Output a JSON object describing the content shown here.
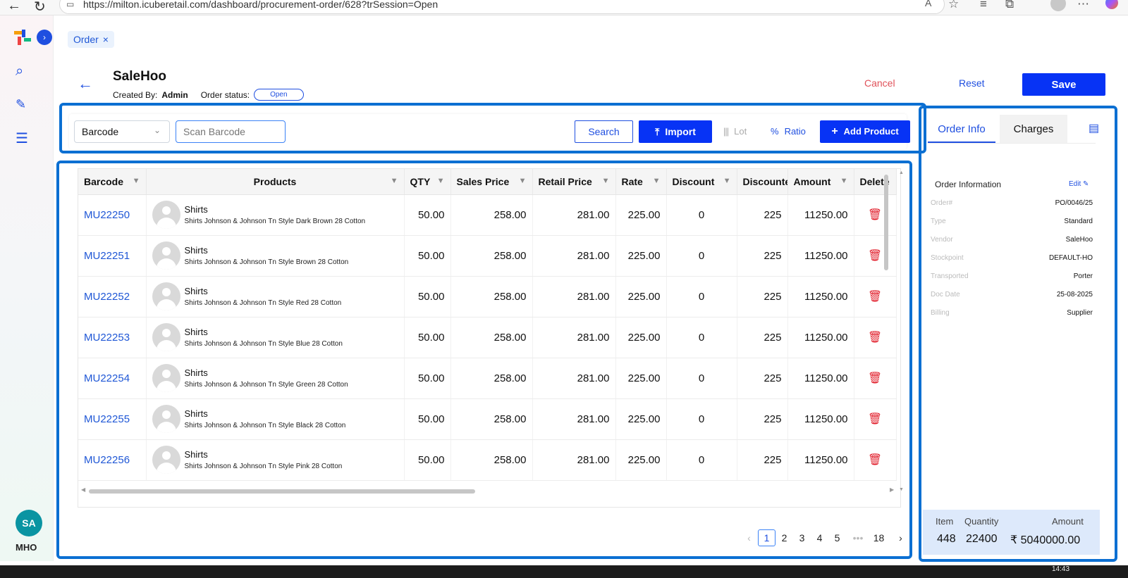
{
  "browser": {
    "url": "https://milton.icuberetail.com/dashboard/procurement-order/628?trSession=Open"
  },
  "chip": {
    "label": "Order",
    "close": "×"
  },
  "header": {
    "title": "SaleHoo",
    "created_by_label": "Created By:",
    "created_by": "Admin",
    "order_status_label": "Order status:",
    "order_status": "Open",
    "cancel_label": "Cancel",
    "reset_label": "Reset",
    "save_label": "Save"
  },
  "toolbar": {
    "select_value": "Barcode",
    "scan_placeholder": "Scan Barcode",
    "search_label": "Search",
    "import_label": "Import",
    "lot_label": "Lot",
    "ratio_label": "Ratio",
    "add_label": "Add Product"
  },
  "table": {
    "headers": [
      "Barcode",
      "Products",
      "QTY",
      "Sales Price",
      "Retail Price",
      "Rate",
      "Discount",
      "Discounte",
      "Amount",
      "Delete"
    ],
    "rows": [
      {
        "barcode": "MU22250",
        "name": "Shirts",
        "desc": "Shirts Johnson & Johnson Tn Style Dark Brown 28 Cotton",
        "qty": "50.00",
        "sales": "258.00",
        "retail": "281.00",
        "rate": "225.00",
        "discount": "0",
        "disc2": "225",
        "amount": "11250.00"
      },
      {
        "barcode": "MU22251",
        "name": "Shirts",
        "desc": "Shirts Johnson & Johnson Tn Style Brown 28 Cotton",
        "qty": "50.00",
        "sales": "258.00",
        "retail": "281.00",
        "rate": "225.00",
        "discount": "0",
        "disc2": "225",
        "amount": "11250.00"
      },
      {
        "barcode": "MU22252",
        "name": "Shirts",
        "desc": "Shirts Johnson & Johnson Tn Style Red 28 Cotton",
        "qty": "50.00",
        "sales": "258.00",
        "retail": "281.00",
        "rate": "225.00",
        "discount": "0",
        "disc2": "225",
        "amount": "11250.00"
      },
      {
        "barcode": "MU22253",
        "name": "Shirts",
        "desc": "Shirts Johnson & Johnson Tn Style Blue 28 Cotton",
        "qty": "50.00",
        "sales": "258.00",
        "retail": "281.00",
        "rate": "225.00",
        "discount": "0",
        "disc2": "225",
        "amount": "11250.00"
      },
      {
        "barcode": "MU22254",
        "name": "Shirts",
        "desc": "Shirts Johnson & Johnson Tn Style Green 28 Cotton",
        "qty": "50.00",
        "sales": "258.00",
        "retail": "281.00",
        "rate": "225.00",
        "discount": "0",
        "disc2": "225",
        "amount": "11250.00"
      },
      {
        "barcode": "MU22255",
        "name": "Shirts",
        "desc": "Shirts Johnson & Johnson Tn Style Black 28 Cotton",
        "qty": "50.00",
        "sales": "258.00",
        "retail": "281.00",
        "rate": "225.00",
        "discount": "0",
        "disc2": "225",
        "amount": "11250.00"
      },
      {
        "barcode": "MU22256",
        "name": "Shirts",
        "desc": "Shirts Johnson & Johnson Tn Style Pink 28 Cotton",
        "qty": "50.00",
        "sales": "258.00",
        "retail": "281.00",
        "rate": "225.00",
        "discount": "0",
        "disc2": "225",
        "amount": "11250.00"
      }
    ]
  },
  "pagination": {
    "pages": [
      "1",
      "2",
      "3",
      "4",
      "5"
    ],
    "ellipsis": "•••",
    "last": "18",
    "current": "1"
  },
  "panel": {
    "tab_info": "Order Info",
    "tab_charges": "Charges",
    "section_title": "Order Information",
    "edit_label": "Edit",
    "fields": [
      {
        "k": "Order#",
        "v": "PO/0046/25"
      },
      {
        "k": "Type",
        "v": "Standard"
      },
      {
        "k": "Vendor",
        "v": "SaleHoo"
      },
      {
        "k": "Stockpoint",
        "v": "DEFAULT-HO"
      },
      {
        "k": "Transported",
        "v": "Porter"
      },
      {
        "k": "Doc Date",
        "v": "25-08-2025"
      },
      {
        "k": "Billing",
        "v": "Supplier"
      }
    ],
    "summary": {
      "item_label": "Item",
      "item_value": "448",
      "qty_label": "Quantity",
      "qty_value": "22400",
      "amount_label": "Amount",
      "amount_value": "₹ 5040000.00"
    }
  },
  "sidebar": {
    "avatar": "SA",
    "org": "MHO"
  },
  "taskbar": {
    "time": "14:43"
  },
  "colors": {
    "primary": "#0733f5",
    "link": "#1f57d6",
    "danger": "#e11d2a",
    "annotation": "#0b6fd2"
  }
}
